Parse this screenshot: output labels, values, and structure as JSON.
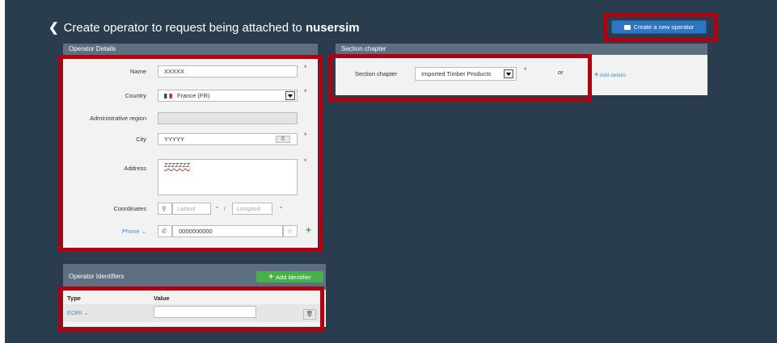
{
  "header": {
    "title_prefix": "Create operator to request being attached to",
    "title_user": "nusersim",
    "create_button": "Create a new operator"
  },
  "operator_details": {
    "heading": "Operator Details",
    "name_label": "Name",
    "name_value": "XXXXX",
    "country_label": "Country",
    "country_value": "France (FR)",
    "admin_region_label": "Administrative region",
    "admin_region_value": "",
    "city_label": "City",
    "city_value": "YYYYY",
    "city_btn": "0",
    "address_label": "Address",
    "address_value": "ZZZZZZZ",
    "coordinates_label": "Coordinates",
    "latitude_placeholder": "Latitud",
    "longitude_placeholder": "Longitud",
    "degree_symbol": "°",
    "slash": "/",
    "phone_label": "Phone",
    "phone_value": "0000000000"
  },
  "section_chapter": {
    "heading": "Section chapter",
    "label": "Section chapter",
    "selected": "Imported Timber Products",
    "or_text": "or",
    "add_details": "Add details"
  },
  "identifiers": {
    "heading": "Operator Identifiers",
    "add_button": "Add identifier",
    "col_type": "Type",
    "col_value": "Value",
    "row_type": "EORI",
    "row_value": ""
  },
  "required_mark": "*",
  "colors": {
    "highlight": "#b3000f",
    "panel_header": "#5d6f81",
    "background": "#2a3d4f",
    "primary": "#2f76c0",
    "success": "#48b04a"
  }
}
